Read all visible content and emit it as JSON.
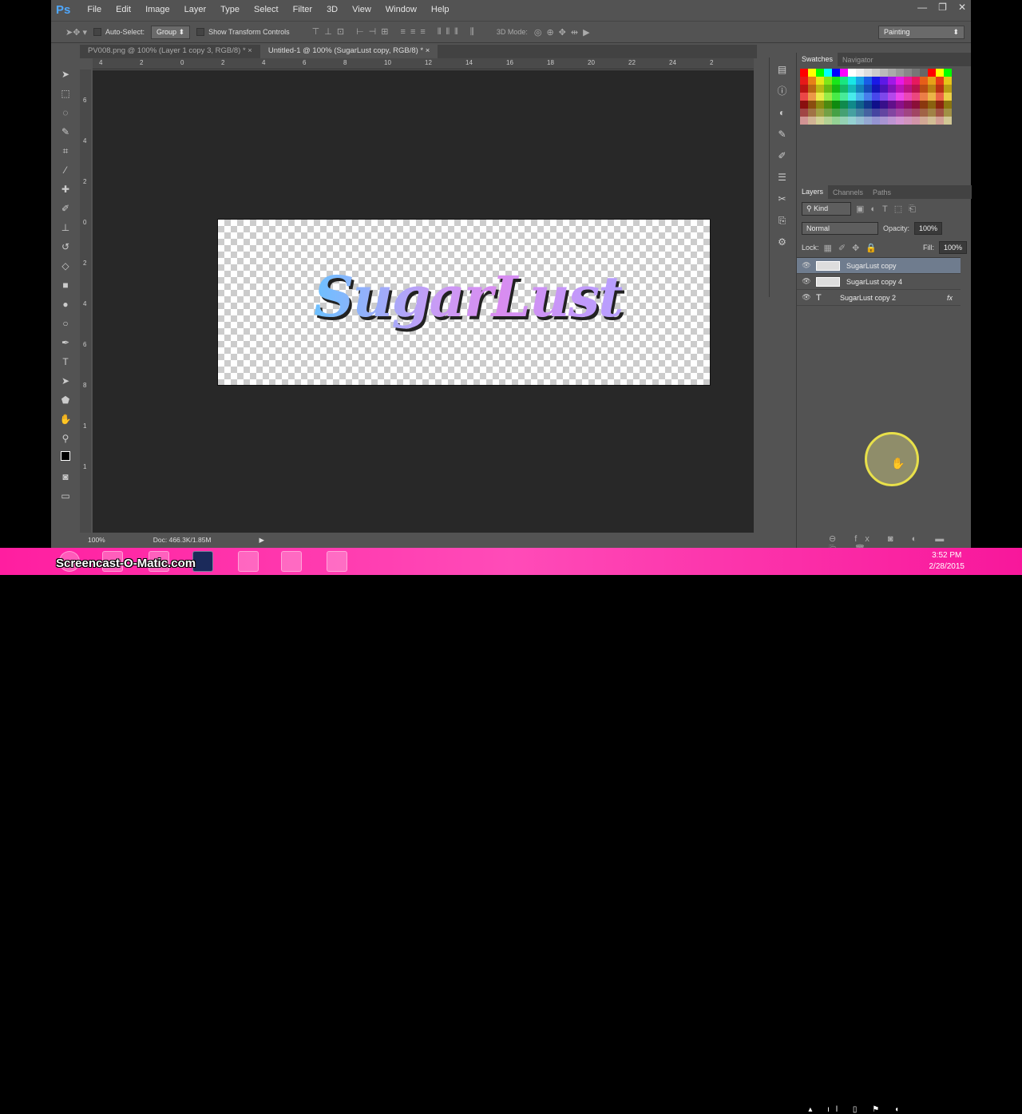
{
  "app": {
    "logo": "Ps",
    "menus": [
      "File",
      "Edit",
      "Image",
      "Layer",
      "Type",
      "Select",
      "Filter",
      "3D",
      "View",
      "Window",
      "Help"
    ],
    "window_controls": [
      "—",
      "❐",
      "✕"
    ]
  },
  "options": {
    "auto_select_label": "Auto-Select:",
    "auto_select_value": "Group",
    "show_transform_label": "Show Transform Controls",
    "mode_3d_label": "3D Mode:",
    "workspace": "Painting"
  },
  "tabs": [
    {
      "label": "PV008.png @ 100% (Layer 1 copy 3, RGB/8) *",
      "close": "×"
    },
    {
      "label": "Untitled-1 @ 100% (SugarLust copy, RGB/8) *",
      "close": "×"
    }
  ],
  "rulers": {
    "top": [
      "4",
      "2",
      "0",
      "2",
      "4",
      "6",
      "8",
      "10",
      "12",
      "14",
      "16",
      "18",
      "20",
      "22",
      "24",
      "2"
    ],
    "left": [
      "6",
      "4",
      "2",
      "0",
      "2",
      "4",
      "6",
      "8",
      "1",
      "1"
    ]
  },
  "canvas": {
    "artwork_text": "SugarLust"
  },
  "status": {
    "zoom": "100%",
    "doc": "Doc: 466.3K/1.85M"
  },
  "swatches_panel": {
    "tabs": [
      "Swatches",
      "Navigator"
    ]
  },
  "layers_panel": {
    "tabs": [
      "Layers",
      "Channels",
      "Paths"
    ],
    "filter": "Kind",
    "blend_mode": "Normal",
    "opacity_label": "Opacity:",
    "opacity": "100%",
    "lock_label": "Lock:",
    "fill_label": "Fill:",
    "fill": "100%",
    "layers": [
      {
        "name": "SugarLust copy",
        "selected": true,
        "type": "raster"
      },
      {
        "name": "SugarLust copy 4",
        "selected": false,
        "type": "raster"
      },
      {
        "name": "SugarLust copy 2",
        "selected": false,
        "type": "text",
        "fx": "fx"
      }
    ]
  },
  "taskbar": {
    "watermark": "Screencast-O-Matic.com",
    "time": "3:52 PM",
    "date": "2/28/2015",
    "accent": "#ff1ea0"
  }
}
